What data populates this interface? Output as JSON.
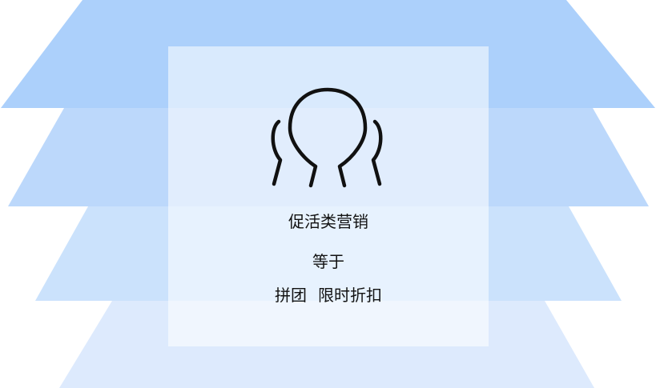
{
  "card": {
    "icon": "people-group-icon",
    "title": "促活类营销",
    "connector": "等于",
    "examples": [
      "拼团",
      "限时折扣"
    ]
  },
  "colors": {
    "layer_1": "#acd0fb",
    "layer_2": "#bcd8fb",
    "layer_3": "#cbe2fc",
    "layer_4": "#ddeafd",
    "icon_stroke": "#111111",
    "text": "#111111"
  }
}
